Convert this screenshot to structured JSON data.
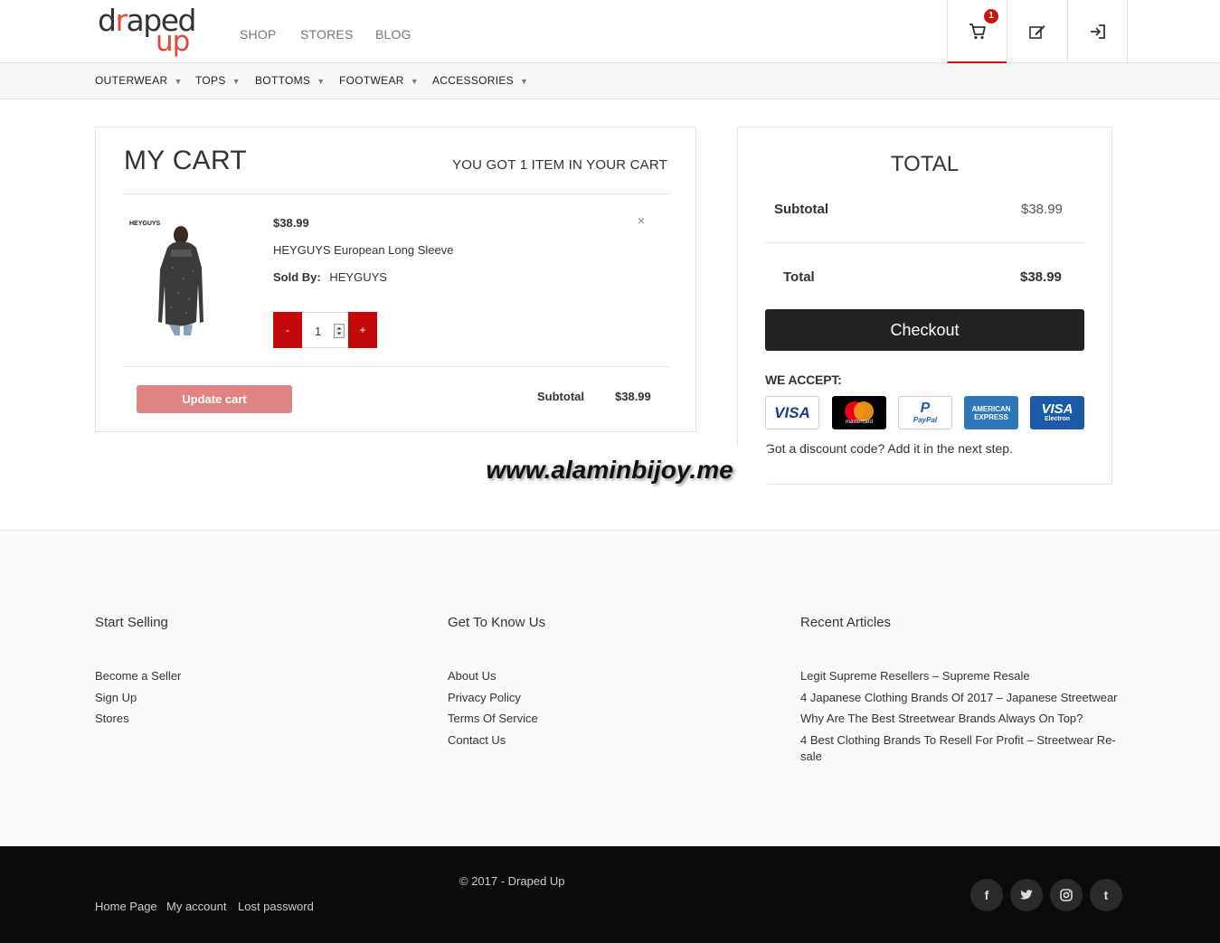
{
  "header": {
    "logo": {
      "line1_a": "d",
      "line1_b": "r",
      "line1_c": "aped",
      "line2": "up"
    },
    "nav": [
      "SHOP",
      "STORES",
      "BLOG"
    ],
    "cart_badge": "1"
  },
  "categories": [
    "OUTERWEAR",
    "TOPS",
    "BOTTOMS",
    "FOOTWEAR",
    "ACCESSORIES"
  ],
  "cart": {
    "title": "MY CART",
    "count_text": "YOU GOT 1 ITEM IN YOUR CART",
    "item": {
      "price": "$38.99",
      "name": "HEYGUYS European Long Sleeve",
      "sold_by_label": "Sold By:",
      "seller": "HEYGUYS",
      "brand_tag": "HEYGUYS",
      "quantity": "1",
      "remove": "×",
      "minus": "-",
      "plus": "+"
    },
    "update_label": "Update cart",
    "subtotal_label": "Subtotal",
    "subtotal_value": "$38.99"
  },
  "totals": {
    "title": "TOTAL",
    "subtotal_label": "Subtotal",
    "subtotal_value": "$38.99",
    "total_label": "Total",
    "total_value": "$38.99",
    "checkout_label": "Checkout",
    "accept_label": "WE ACCEPT:",
    "cards": [
      {
        "label": "VISA",
        "bg": "#ffffff",
        "fg": "#1a3b8f",
        "icon": "visa-card-icon"
      },
      {
        "label": "mastercard",
        "bg": "#000000",
        "fg": "#ffffff",
        "icon": "mastercard-icon"
      },
      {
        "label": "PayPal",
        "bg": "#ffffff",
        "fg": "#1f5fa8",
        "icon": "paypal-icon"
      },
      {
        "label": "AMERICAN EXPRESS",
        "bg": "#2e77bb",
        "fg": "#ffffff",
        "icon": "amex-icon"
      },
      {
        "label": "VISA",
        "sub": "Electron",
        "bg": "#1a5aa6",
        "fg": "#ffffff",
        "icon": "visa-electron-icon"
      }
    ],
    "discount_text": "Got a discount code? Add it in the next step."
  },
  "watermark": "www.alaminbijoy.me",
  "footer": {
    "columns": [
      {
        "heading": "Start Selling",
        "links": [
          "Become a Seller",
          "Sign Up",
          "Stores"
        ]
      },
      {
        "heading": "Get To Know Us",
        "links": [
          "About Us",
          "Privacy Policy",
          "Terms Of Service",
          "Contact Us"
        ]
      },
      {
        "heading": "Recent Articles",
        "links": [
          "Legit Supreme Resellers – Supreme Resale",
          "4 Japanese Clothing Brands Of 2017 – Japanese Streetwear",
          "Why Are The Best Streetwear Brands Always On Top?",
          "4 Best Clothing Brands To Resell For Profit – Streetwear Re-",
          "sale"
        ]
      }
    ],
    "copyright": "© 2017 - Draped Up",
    "bottom_links": [
      "Home Page",
      "My account",
      "Lost password"
    ],
    "social": [
      {
        "glyph": "f",
        "icon": "facebook-icon"
      },
      {
        "glyph": "t",
        "icon": "twitter-icon"
      },
      {
        "glyph": "◎",
        "icon": "instagram-icon"
      },
      {
        "glyph": "t",
        "icon": "tumblr-icon"
      }
    ]
  },
  "colors": {
    "accent": "#c4090b",
    "update_button": "#e08383",
    "checkout": "#222222",
    "footer_bottom": "#0b0b0b"
  }
}
